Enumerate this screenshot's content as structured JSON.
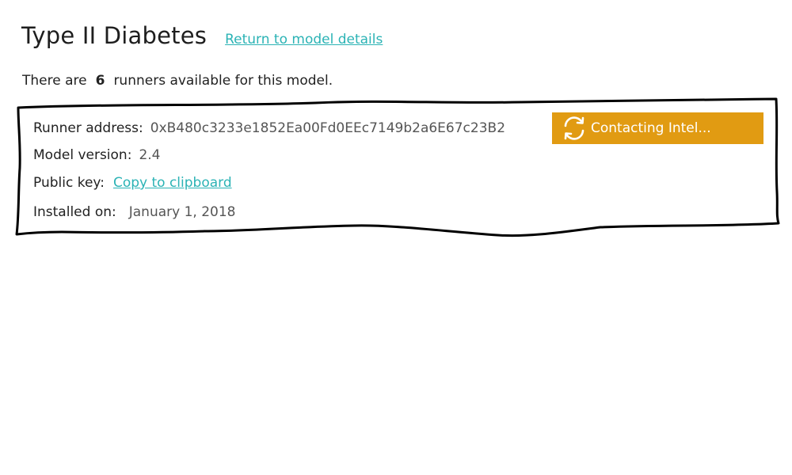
{
  "header": {
    "title": "Type II Diabetes",
    "return_link": "Return to model details"
  },
  "summary": {
    "prefix": "There are",
    "count": "6",
    "suffix": "runners available for this model."
  },
  "runner": {
    "address_label": "Runner address:",
    "address_value": "0xB480c3233e1852Ea00Fd0EEc7149b2a6E67c23B2",
    "version_label": "Model version:",
    "version_value": "2.4",
    "pubkey_label": "Public key:",
    "pubkey_link": "Copy to clipboard",
    "installed_label": "Installed on:",
    "installed_value": "January 1, 2018",
    "status_label": "Contacting Intel...",
    "status_icon": "refresh-icon"
  },
  "colors": {
    "link": "#2bb3b5",
    "status_bg": "#e19b12",
    "border": "#000000"
  }
}
